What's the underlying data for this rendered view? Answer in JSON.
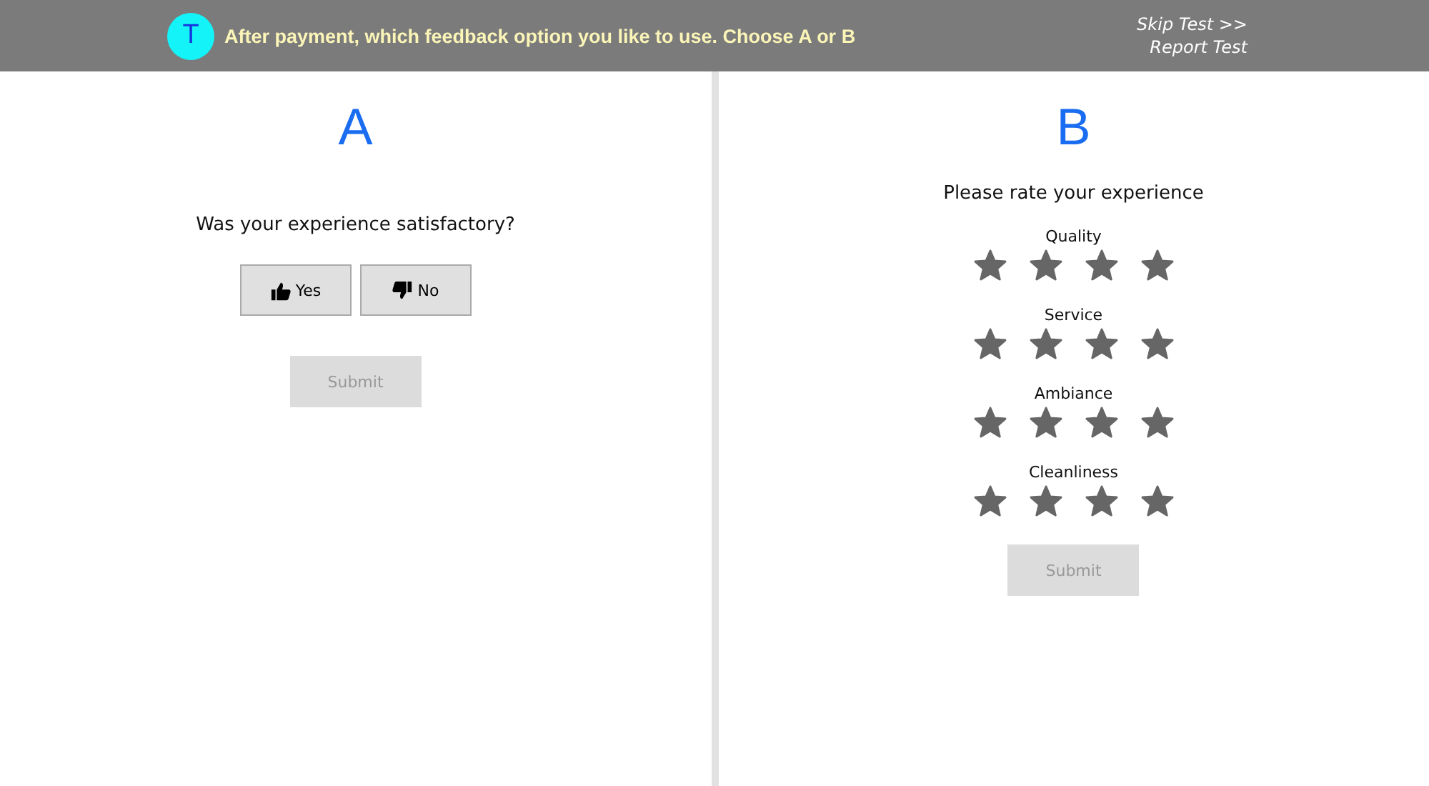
{
  "header": {
    "avatar": "T",
    "question": "After payment, which feedback option you like to use. Choose A or B",
    "links": [
      "Skip Test >>",
      "Report Test"
    ]
  },
  "option_a": {
    "letter": "A",
    "prompt": "Was your experience satisfactory?",
    "buttons": [
      {
        "label": "Yes",
        "kind": "thumbs-up"
      },
      {
        "label": "No",
        "kind": "thumbs-down"
      }
    ],
    "submit": {
      "label": "Submit",
      "disabled": true
    }
  },
  "option_b": {
    "letter": "B",
    "prompt": "Please rate your experience",
    "ratings": [
      {
        "label": "Quality",
        "stars": 4
      },
      {
        "label": "Service",
        "stars": 4
      },
      {
        "label": "Ambiance",
        "stars": 4
      },
      {
        "label": "Cleanliness",
        "stars": 4
      }
    ],
    "submit": {
      "label": "Submit",
      "disabled": true
    }
  }
}
